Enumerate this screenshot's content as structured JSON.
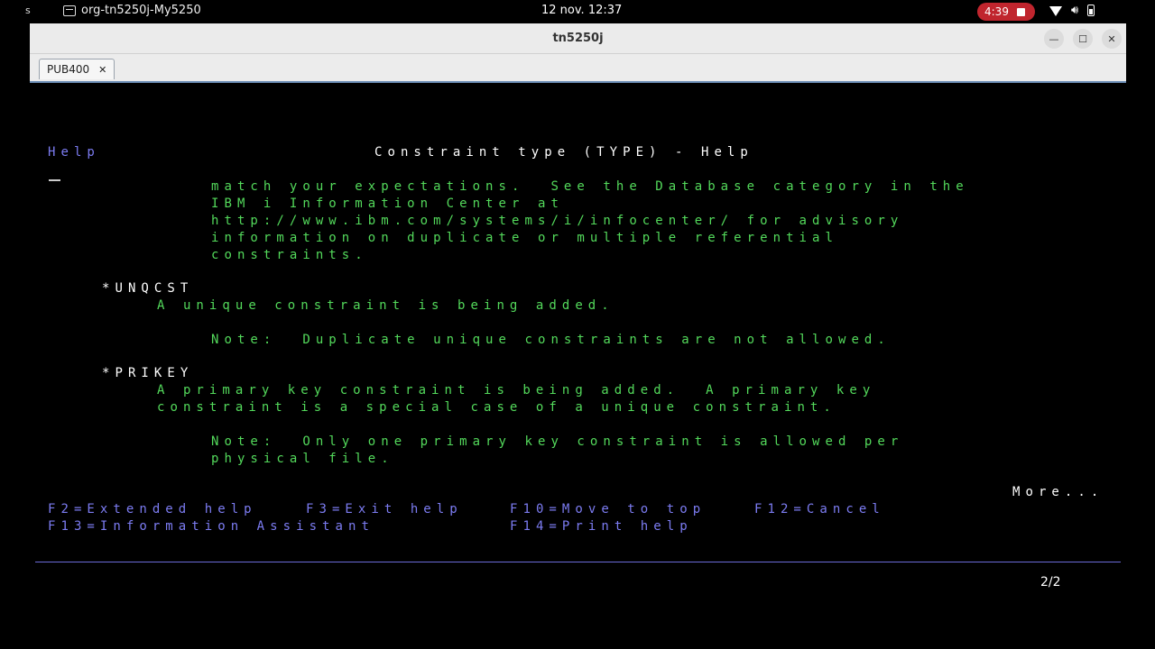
{
  "topbar": {
    "left_edge": "s",
    "app_name": "org-tn5250j-My5250",
    "clock": "12 nov.  12:37",
    "recording_time": "4:39"
  },
  "window": {
    "title": "tn5250j",
    "tab_label": "PUB400"
  },
  "screen": {
    "header_left": "Help",
    "header_title": "Constraint type (TYPE) - Help",
    "lines": [
      "match your expectations.  See the Database category in the",
      "IBM i Information Center at",
      "http://www.ibm.com/systems/i/infocenter/ for advisory",
      "information on duplicate or multiple referential",
      "constraints."
    ],
    "unqcst_keyword": "*UNQCST",
    "unqcst_desc": "A unique constraint is being added.",
    "unqcst_note": "Note:  Duplicate unique constraints are not allowed.",
    "prikey_keyword": "*PRIKEY",
    "prikey_desc_1": "A primary key constraint is being added.  A primary key",
    "prikey_desc_2": "constraint is a special case of a unique constraint.",
    "prikey_note_1": "Note:  Only one primary key constraint is allowed per",
    "prikey_note_2": "physical file.",
    "more": "More...",
    "fkeys_row1": {
      "f2": "F2=Extended help",
      "f3": "F3=Exit help",
      "f10": "F10=Move to top",
      "f12": "F12=Cancel"
    },
    "fkeys_row2": {
      "f13": "F13=Information Assistant",
      "f14": "F14=Print help"
    },
    "page_indicator": "2/2"
  },
  "colors": {
    "field_green": "#53d95b",
    "text_white": "#ffffff",
    "fkey_blue": "#7c7cf2",
    "recording_red": "#c0252e"
  }
}
